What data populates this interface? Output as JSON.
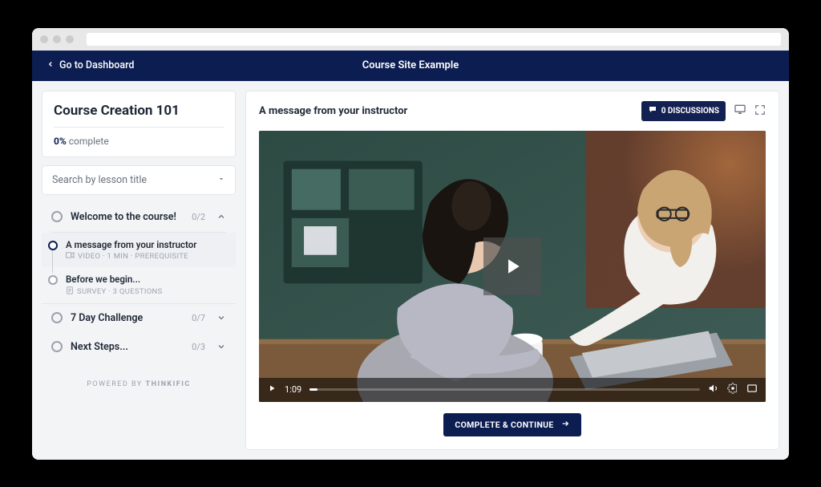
{
  "header": {
    "back_label": "Go to Dashboard",
    "site_title": "Course Site Example"
  },
  "sidebar": {
    "course_title": "Course Creation 101",
    "progress_pct": "0%",
    "progress_word": "complete",
    "search_placeholder": "Search by lesson title",
    "powered_prefix": "POWERED BY ",
    "powered_brand": "THINKIFIC",
    "chapters": [
      {
        "title": "Welcome to the course!",
        "count": "0/2",
        "expanded": true
      },
      {
        "title": "7 Day Challenge",
        "count": "0/7",
        "expanded": false
      },
      {
        "title": "Next Steps...",
        "count": "0/3",
        "expanded": false
      }
    ],
    "lessons": [
      {
        "title": "A message from your instructor",
        "meta": "VIDEO · 1 MIN · PREREQUISITE",
        "active": true
      },
      {
        "title": "Before we begin...",
        "meta": "SURVEY · 3 QUESTIONS",
        "active": false
      }
    ]
  },
  "main": {
    "lesson_title": "A message from your instructor",
    "discussions_label": "0 DISCUSSIONS",
    "video_time": "1:09",
    "complete_label": "COMPLETE & CONTINUE"
  }
}
